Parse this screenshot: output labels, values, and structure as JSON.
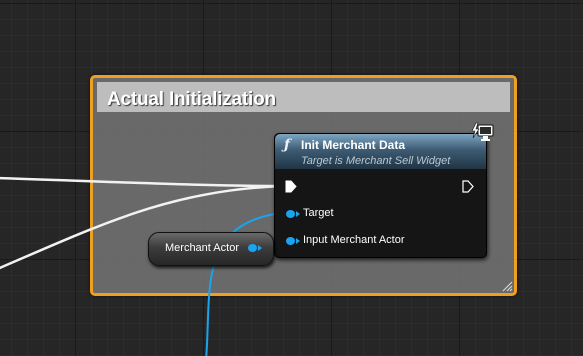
{
  "comment": {
    "title": "Actual Initialization",
    "color": "#f0a020"
  },
  "function_node": {
    "icon": "function-f-icon",
    "title": "Init Merchant Data",
    "subtitle": "Target is Merchant Sell Widget",
    "header_color": "#3e5c74",
    "corner_icon": "networked-monitor-icon",
    "pins": {
      "exec_in": "exec-in-pin",
      "exec_out": "exec-out-pin",
      "target": "Target",
      "input_merchant_actor": "Input Merchant Actor"
    }
  },
  "variable_node": {
    "label": "Merchant Actor",
    "pin_color": "#1aa4ee"
  },
  "wires": {
    "exec_color": "#ffffff",
    "object_color": "#1aa4ee"
  }
}
